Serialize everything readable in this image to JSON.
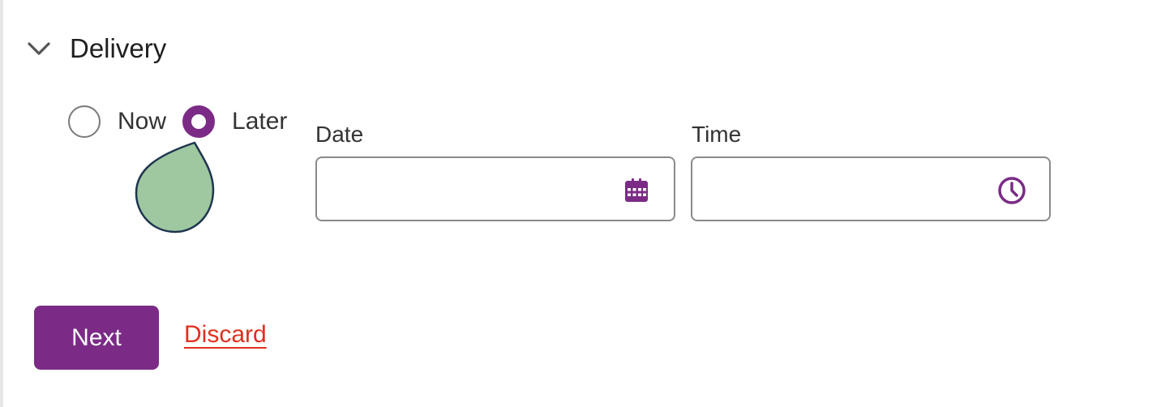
{
  "section": {
    "title": "Delivery",
    "expanded": true,
    "toggle_icon": "chevron-down-icon"
  },
  "delivery_options": {
    "selected": "Later",
    "options": [
      {
        "label": "Now",
        "checked": false
      },
      {
        "label": "Later",
        "checked": true
      }
    ]
  },
  "date_field": {
    "label": "Date",
    "value": "",
    "icon": "calendar-icon"
  },
  "time_field": {
    "label": "Time",
    "value": "",
    "icon": "clock-icon"
  },
  "actions": {
    "next_label": "Next",
    "discard_label": "Discard"
  },
  "colors": {
    "accent": "#7b2b86",
    "danger": "#e0301e",
    "cursor_fill": "#9fc8a0",
    "cursor_outline": "#1f3550"
  }
}
